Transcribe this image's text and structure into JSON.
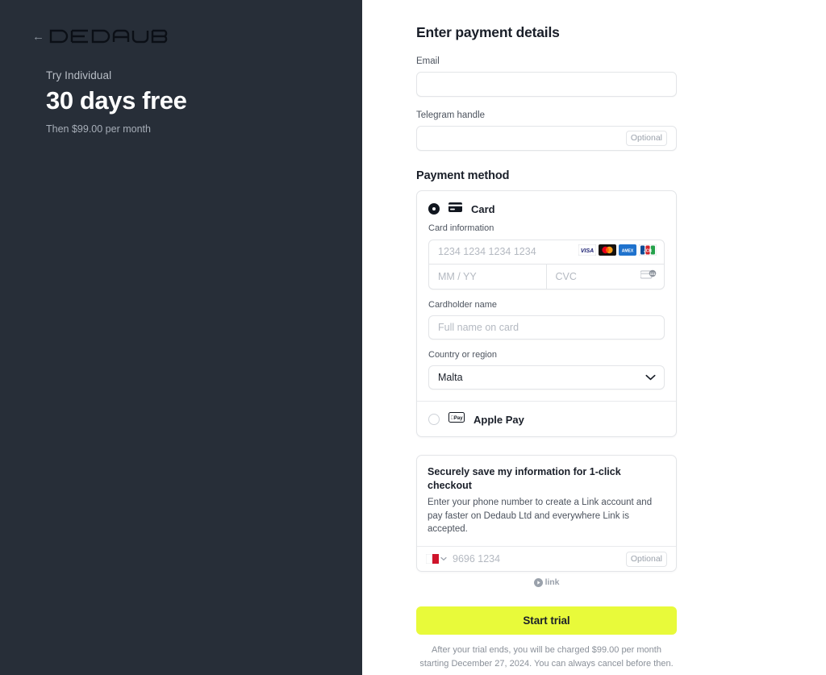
{
  "left_panel": {
    "back_label": "←",
    "logo_text": "DEDAUB",
    "plan_try": "Try Individual",
    "plan_headline": "30 days free",
    "plan_then": "Then $99.00 per month",
    "bg_color": "#272E38"
  },
  "form": {
    "title": "Enter payment details",
    "email": {
      "label": "Email",
      "value": "",
      "placeholder": ""
    },
    "telegram": {
      "label": "Telegram handle",
      "value": "",
      "placeholder": "",
      "optional_badge": "Optional"
    },
    "payment_method": {
      "section_title": "Payment method",
      "options": [
        {
          "label": "Card",
          "selected": true,
          "icon": "credit-card-icon"
        },
        {
          "label": "Apple Pay",
          "selected": false,
          "icon": "apple-pay-icon"
        }
      ],
      "card": {
        "info_label": "Card information",
        "number_placeholder": "1234 1234 1234 1234",
        "expiry_placeholder": "MM / YY",
        "cvc_placeholder": "CVC",
        "brands": [
          "visa",
          "mastercard",
          "amex",
          "jcb"
        ],
        "name_label": "Cardholder name",
        "name_placeholder": "Full name on card",
        "country_label": "Country or region",
        "country_value": "Malta"
      }
    },
    "link": {
      "title": "Securely save my information for 1-click checkout",
      "description": "Enter your phone number to create a Link account and pay faster on Dedaub Ltd and everywhere Link is accepted.",
      "phone_placeholder": "9696 1234",
      "phone_country": "Malta",
      "optional_badge": "Optional",
      "logo_text": "link"
    },
    "cta_label": "Start trial",
    "cta_color": "#E8FA3A",
    "legal_text": "After your trial ends, you will be charged $99.00 per month starting December 27, 2024. You can always cancel before then."
  }
}
